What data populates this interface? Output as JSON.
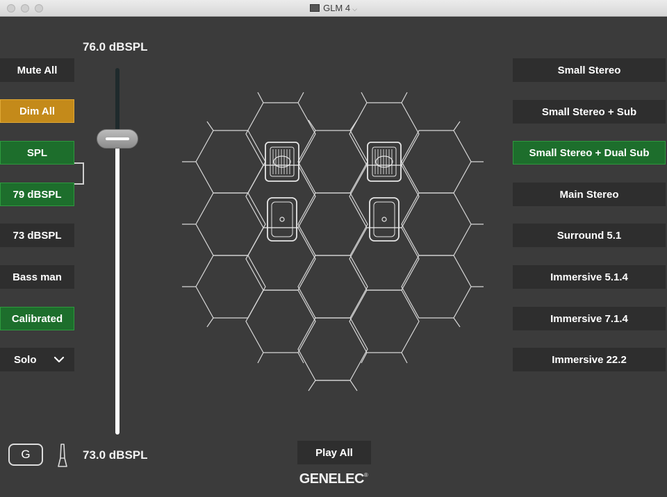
{
  "window": {
    "title": "GLM 4"
  },
  "spl": {
    "top_value": "76.0 dBSPL",
    "bottom_value": "73.0 dBSPL"
  },
  "left_buttons": {
    "mute_all": "Mute All",
    "dim_all": "Dim All",
    "spl": "SPL",
    "preset_79": "79 dBSPL",
    "preset_73": "73 dBSPL",
    "bass_man": "Bass man",
    "calibrated": "Calibrated",
    "solo": "Solo"
  },
  "layouts": {
    "items": [
      {
        "label": "Small Stereo",
        "active": false
      },
      {
        "label": "Small Stereo + Sub",
        "active": false
      },
      {
        "label": "Small Stereo + Dual Sub",
        "active": true
      },
      {
        "label": "Main Stereo",
        "active": false
      },
      {
        "label": "Surround 5.1",
        "active": false
      },
      {
        "label": "Immersive 5.1.4",
        "active": false
      },
      {
        "label": "Immersive 7.1.4",
        "active": false
      },
      {
        "label": "Immersive 22.2",
        "active": false
      }
    ]
  },
  "bottom": {
    "g_label": "G",
    "play_all": "Play All",
    "brand": "GENELEC",
    "brand_mark": "®"
  },
  "colors": {
    "active_green": "#1d6e2c",
    "dim_orange": "#c48a1a",
    "button_bg": "#2e2e2e",
    "panel_bg": "#3b3b3b"
  },
  "icons": {
    "speaker_grid": "hexagon-grid",
    "subwoofer": "subwoofer-icon",
    "monitor": "monitor-speaker-icon",
    "microphone": "microphone-icon",
    "g_logo": "g-logo-icon"
  }
}
